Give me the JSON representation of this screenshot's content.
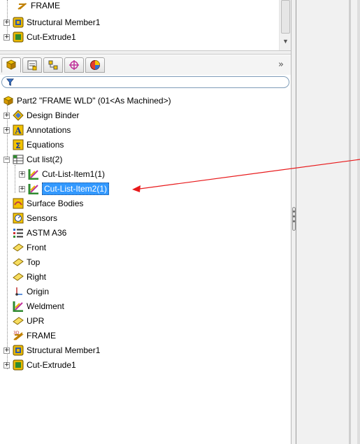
{
  "top_tree": {
    "items": [
      {
        "label": "FRAME"
      },
      {
        "label": "Structural Member1"
      },
      {
        "label": "Cut-Extrude1"
      }
    ]
  },
  "toolbar": {
    "more_label": "»"
  },
  "tree": {
    "root_label": "Part2 \"FRAME WLD\"  (01<As Machined>)",
    "design_binder": "Design Binder",
    "annotations": "Annotations",
    "equations": "Equations",
    "cut_list": "Cut list(2)",
    "cut_item1": "Cut-List-Item1(1)",
    "cut_item2": "Cut-List-Item2(1)",
    "surface_bodies": "Surface Bodies",
    "sensors": "Sensors",
    "material": "ASTM A36",
    "front": "Front",
    "top": "Top",
    "right": "Right",
    "origin": "Origin",
    "weldment": "Weldment",
    "upr": "UPR",
    "frame": "FRAME",
    "structural_member": "Structural Member1",
    "cut_extrude": "Cut-Extrude1"
  },
  "colors": {
    "selection": "#3399ff",
    "annotation_arrow": "#e8191b"
  }
}
